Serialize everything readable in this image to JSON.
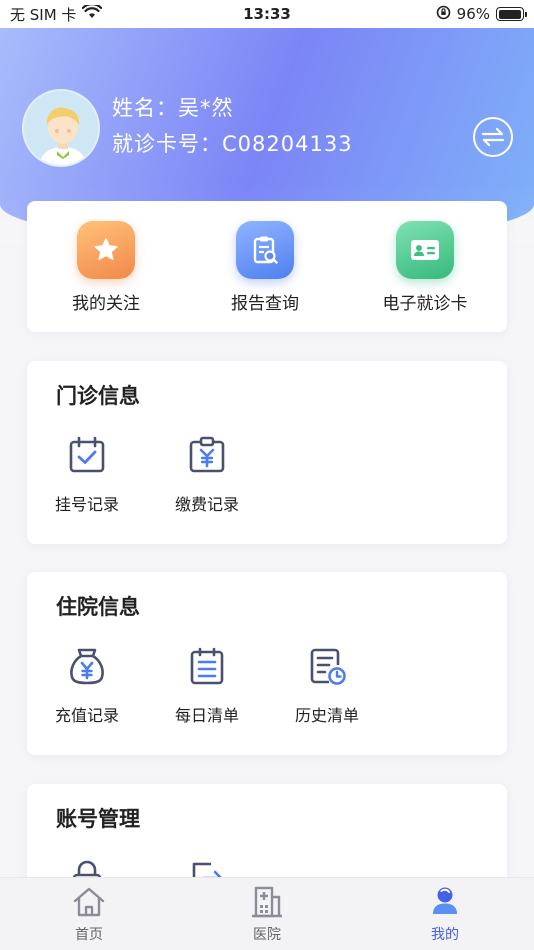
{
  "status_bar": {
    "carrier": "无 SIM 卡",
    "time": "13:33",
    "battery": "96%",
    "battery_level": 0.96
  },
  "profile": {
    "name_label": "姓名：吴*然",
    "card_label": "就诊卡号：C08204133"
  },
  "quick_actions": [
    {
      "label": "我的关注",
      "icon": "star-icon",
      "color": "#f59b51"
    },
    {
      "label": "报告查询",
      "icon": "report-search-icon",
      "color": "#5d8bf4"
    },
    {
      "label": "电子就诊卡",
      "icon": "id-card-icon",
      "color": "#47c98b"
    }
  ],
  "outpatient": {
    "title": "门诊信息",
    "items": [
      {
        "label": "挂号记录",
        "icon": "calendar-check-icon"
      },
      {
        "label": "缴费记录",
        "icon": "payment-clipboard-icon"
      }
    ]
  },
  "inpatient": {
    "title": "住院信息",
    "items": [
      {
        "label": "充值记录",
        "icon": "money-bag-icon"
      },
      {
        "label": "每日清单",
        "icon": "daily-list-icon"
      },
      {
        "label": "历史清单",
        "icon": "history-list-icon"
      }
    ]
  },
  "account": {
    "title": "账号管理"
  },
  "tabs": [
    {
      "label": "首页",
      "icon": "home-icon",
      "active": false
    },
    {
      "label": "医院",
      "icon": "hospital-icon",
      "active": false
    },
    {
      "label": "我的",
      "icon": "profile-icon",
      "active": true
    }
  ],
  "colors": {
    "accent": "#4660e8",
    "icon_stroke": "#4a5070",
    "icon_accent": "#4a7cf2"
  }
}
